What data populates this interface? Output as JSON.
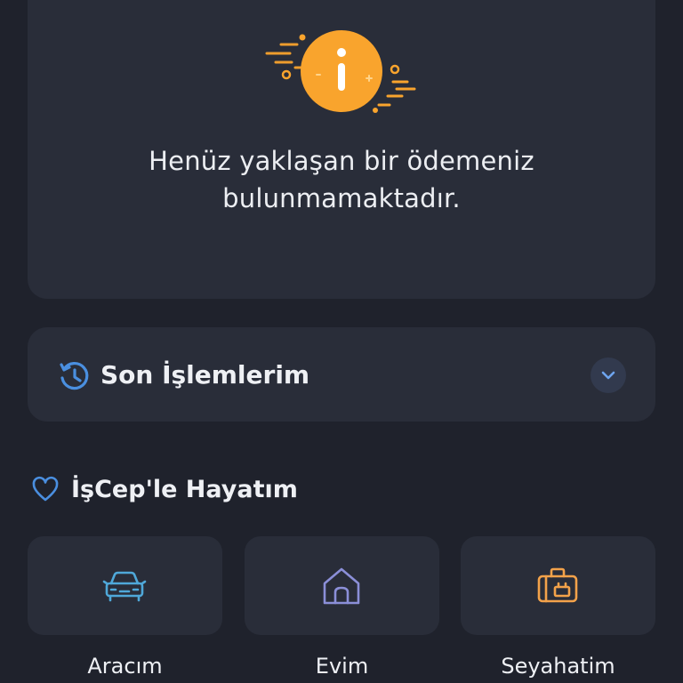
{
  "empty_state": {
    "message_line1": "Henüz yaklaşan bir ödemeniz",
    "message_line2": "bulunmamaktadır.",
    "icon": "info-icon",
    "accent_color": "#f9a42d"
  },
  "recent": {
    "title": "Son İşlemlerim",
    "icon": "history-icon",
    "expand_icon": "chevron-down-icon"
  },
  "life": {
    "title": "İşCep'le Hayatım",
    "icon": "heart-icon",
    "tiles": [
      {
        "label": "Aracım",
        "icon": "car-icon",
        "color": "#4fa8d9"
      },
      {
        "label": "Evim",
        "icon": "home-icon",
        "color": "#8b8fd8"
      },
      {
        "label": "Seyahatim",
        "icon": "luggage-icon",
        "color": "#f3a24a"
      }
    ]
  }
}
